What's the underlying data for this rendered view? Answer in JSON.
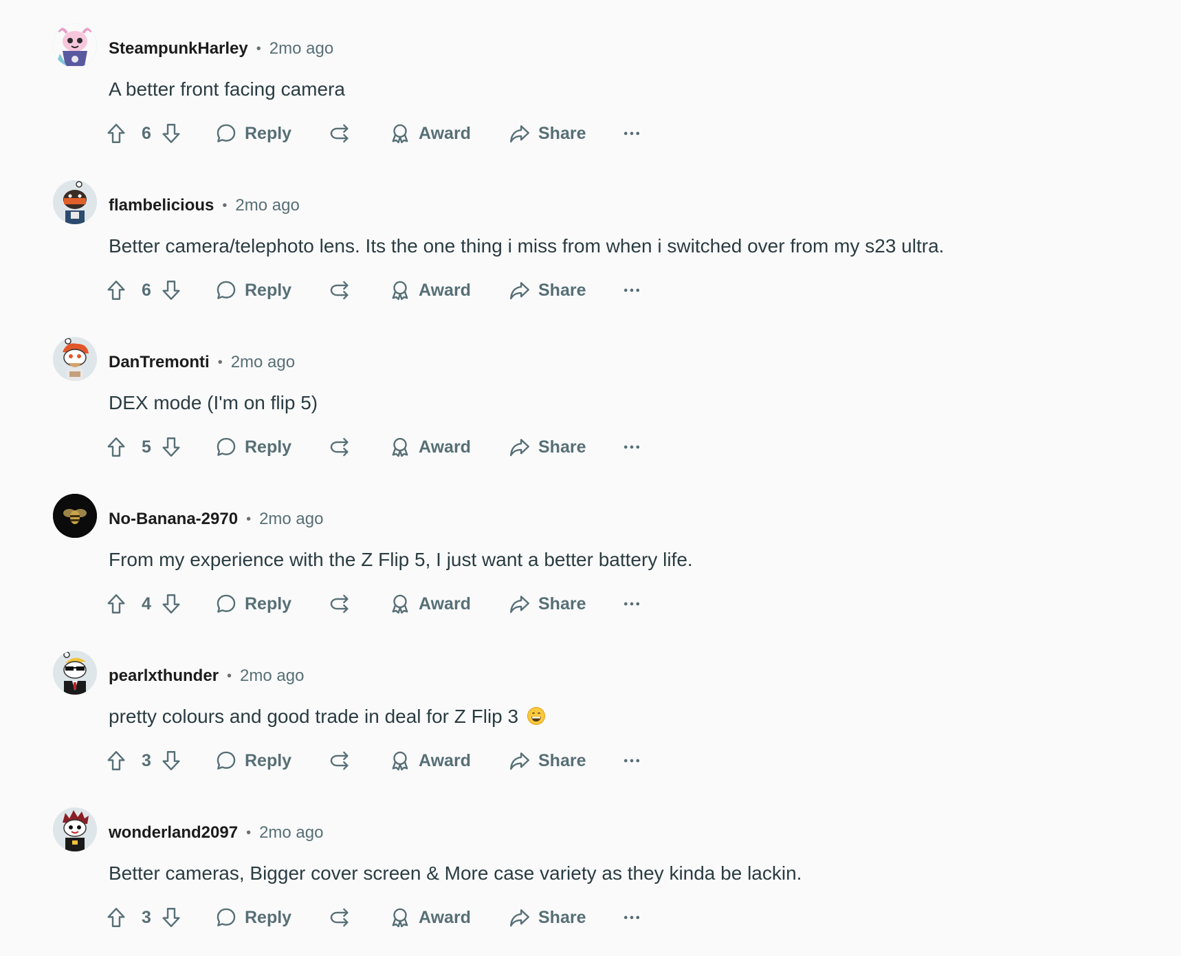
{
  "comments": [
    {
      "username": "SteampunkHarley",
      "time": "2mo ago",
      "body": "A better front facing camera",
      "votes": "6",
      "avatar_icon": "axolotl-avatar-icon",
      "avatar_bg": "#7fc7d9"
    },
    {
      "username": "flambelicious",
      "time": "2mo ago",
      "body": "Better camera/telephoto lens. Its the one thing i miss from when i switched over from my s23 ultra.",
      "votes": "6",
      "avatar_icon": "snoo-masked-avatar-icon",
      "avatar_bg": "#dfe6ea"
    },
    {
      "username": "DanTremonti",
      "time": "2mo ago",
      "body": "DEX mode (I'm on flip 5)",
      "votes": "5",
      "avatar_icon": "snoo-redhair-avatar-icon",
      "avatar_bg": "#dfe6ea"
    },
    {
      "username": "No-Banana-2970",
      "time": "2mo ago",
      "body": "From my experience with the Z Flip 5, I just want a better battery life.",
      "votes": "4",
      "avatar_icon": "bee-avatar-icon",
      "avatar_bg": "#0b0b0b"
    },
    {
      "username": "pearlxthunder",
      "time": "2mo ago",
      "body": "pretty colours and good trade in deal for Z Flip 3",
      "votes": "3",
      "avatar_icon": "snoo-sunglasses-avatar-icon",
      "avatar_bg": "#dfe6ea",
      "emoji": "grinning-face-icon"
    },
    {
      "username": "wonderland2097",
      "time": "2mo ago",
      "body": "Better cameras, Bigger cover screen & More case variety as they kinda be lackin.",
      "votes": "3",
      "avatar_icon": "snoo-spiky-hair-avatar-icon",
      "avatar_bg": "#dfe6ea"
    }
  ],
  "actions": {
    "reply_label": "Reply",
    "award_label": "Award",
    "share_label": "Share",
    "separator": "•"
  },
  "colors": {
    "background": "#fafafa",
    "meta_text": "#576f76",
    "body_text": "#2a3c42",
    "username": "#1c1c1c"
  }
}
